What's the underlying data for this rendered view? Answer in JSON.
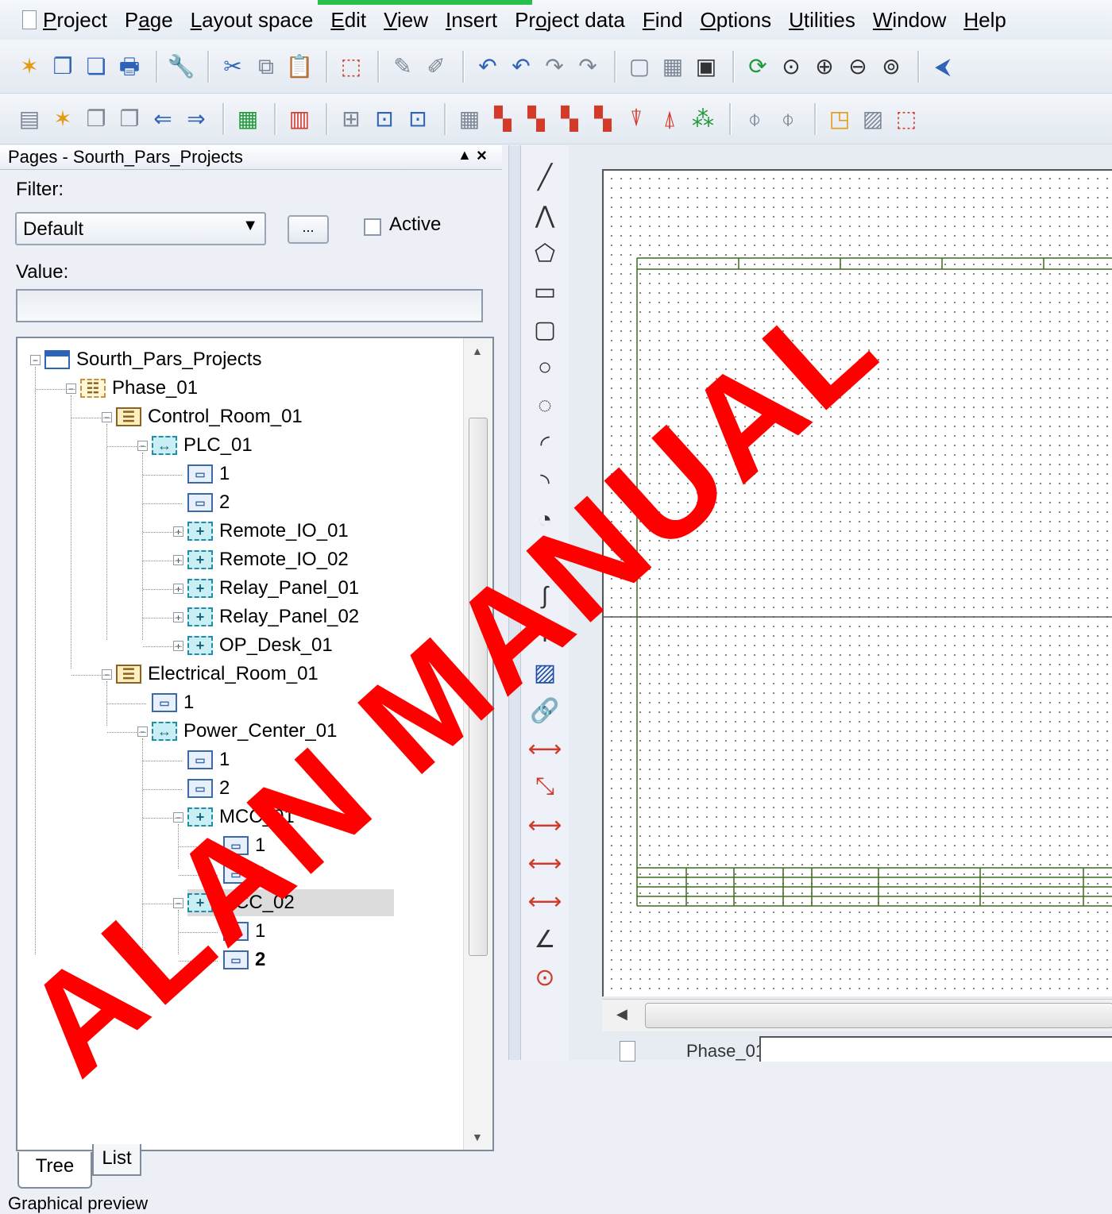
{
  "menubar": {
    "items": [
      {
        "pre": "",
        "acc": "P",
        "post": "roject"
      },
      {
        "pre": "P",
        "acc": "a",
        "post": "ge"
      },
      {
        "pre": "",
        "acc": "L",
        "post": "ayout space"
      },
      {
        "pre": "",
        "acc": "E",
        "post": "dit"
      },
      {
        "pre": "",
        "acc": "V",
        "post": "iew"
      },
      {
        "pre": "",
        "acc": "I",
        "post": "nsert"
      },
      {
        "pre": "Pr",
        "acc": "o",
        "post": "ject data"
      },
      {
        "pre": "",
        "acc": "F",
        "post": "ind"
      },
      {
        "pre": "",
        "acc": "O",
        "post": "ptions"
      },
      {
        "pre": "",
        "acc": "U",
        "post": "tilities"
      },
      {
        "pre": "",
        "acc": "W",
        "post": "indow"
      },
      {
        "pre": "",
        "acc": "H",
        "post": "elp"
      }
    ]
  },
  "toolbar1": [
    {
      "name": "new-project-icon",
      "glyph": "✶",
      "color": "c-orange"
    },
    {
      "name": "open-project-icon",
      "glyph": "❐",
      "color": "c-blue"
    },
    {
      "name": "close-project-icon",
      "glyph": "❏",
      "color": "c-blue"
    },
    {
      "name": "print-icon",
      "glyph": "🖶",
      "color": "c-blue"
    },
    {
      "sep": true
    },
    {
      "name": "settings-wrench-icon",
      "glyph": "🔧",
      "color": "c-orange"
    },
    {
      "sep": true
    },
    {
      "name": "cut-icon",
      "glyph": "✂",
      "color": "c-blue"
    },
    {
      "name": "copy-icon",
      "glyph": "⧉",
      "color": "c-gray"
    },
    {
      "name": "paste-icon",
      "glyph": "📋",
      "color": "c-orange"
    },
    {
      "sep": true
    },
    {
      "name": "delete-selection-icon",
      "glyph": "⬚",
      "color": "c-red"
    },
    {
      "sep": true
    },
    {
      "name": "format-brush-icon",
      "glyph": "✎",
      "color": "c-gray"
    },
    {
      "name": "format-apply-icon",
      "glyph": "✐",
      "color": "c-gray"
    },
    {
      "sep": true
    },
    {
      "name": "undo-icon",
      "glyph": "↶",
      "color": "c-blue"
    },
    {
      "name": "undo-list-icon",
      "glyph": "↶",
      "color": "c-blue"
    },
    {
      "name": "redo-icon",
      "glyph": "↷",
      "color": "c-gray"
    },
    {
      "name": "redo-list-icon",
      "glyph": "↷",
      "color": "c-gray"
    },
    {
      "sep": true
    },
    {
      "name": "page-icon",
      "glyph": "▢",
      "color": "c-gray"
    },
    {
      "name": "grid-icon",
      "glyph": "▦",
      "color": "c-gray"
    },
    {
      "name": "graphic-view-icon",
      "glyph": "▣",
      "color": "c-black"
    },
    {
      "sep": true
    },
    {
      "name": "refresh-icon",
      "glyph": "⟳",
      "color": "c-green"
    },
    {
      "name": "zoom-window-icon",
      "glyph": "⊙",
      "color": "c-black"
    },
    {
      "name": "zoom-in-icon",
      "glyph": "⊕",
      "color": "c-black"
    },
    {
      "name": "zoom-out-icon",
      "glyph": "⊖",
      "color": "c-black"
    },
    {
      "name": "zoom-100-icon",
      "glyph": "⊚",
      "color": "c-black"
    },
    {
      "sep": true
    },
    {
      "name": "back-arrow-icon",
      "glyph": "⮜",
      "color": "c-blue"
    }
  ],
  "toolbar2": [
    {
      "name": "page-properties-icon",
      "glyph": "▤",
      "color": "c-gray"
    },
    {
      "name": "new-page-icon",
      "glyph": "✶",
      "color": "c-orange"
    },
    {
      "name": "open-page-icon",
      "glyph": "❐",
      "color": "c-gray"
    },
    {
      "name": "page-copy-icon",
      "glyph": "❐",
      "color": "c-gray"
    },
    {
      "name": "previous-page-icon",
      "glyph": "⇐",
      "color": "c-blue"
    },
    {
      "name": "next-page-icon",
      "glyph": "⇒",
      "color": "c-blue"
    },
    {
      "sep": true
    },
    {
      "name": "insert-symbol-icon",
      "glyph": "▦",
      "color": "c-green"
    },
    {
      "sep": true
    },
    {
      "name": "plc-box-icon",
      "glyph": "▥",
      "color": "c-red"
    },
    {
      "sep": true
    },
    {
      "name": "device-icon",
      "glyph": "⊞",
      "color": "c-gray"
    },
    {
      "name": "terminal-icon",
      "glyph": "⊡",
      "color": "c-blue"
    },
    {
      "name": "terminal-strip-icon",
      "glyph": "⊡",
      "color": "c-blue"
    },
    {
      "sep": true
    },
    {
      "name": "connector-icon",
      "glyph": "▦",
      "color": "c-gray"
    },
    {
      "name": "cable-icon",
      "glyph": "▚",
      "color": "c-red"
    },
    {
      "name": "cable-definition-icon",
      "glyph": "▚",
      "color": "c-red"
    },
    {
      "name": "shield-icon",
      "glyph": "▚",
      "color": "c-red"
    },
    {
      "name": "potential-icon",
      "glyph": "▚",
      "color": "c-red"
    },
    {
      "name": "interruption-point-icon",
      "glyph": "⍒",
      "color": "c-red"
    },
    {
      "name": "interruption-point-up-icon",
      "glyph": "⍋",
      "color": "c-red"
    },
    {
      "name": "network-definition-icon",
      "glyph": "⁂",
      "color": "c-green"
    },
    {
      "sep": true
    },
    {
      "name": "plug-icon",
      "glyph": "⌽",
      "color": "c-gray"
    },
    {
      "name": "plug-pin-icon",
      "glyph": "⌽",
      "color": "c-gray"
    },
    {
      "sep": true
    },
    {
      "name": "structure-box-icon",
      "glyph": "◳",
      "color": "c-orange"
    },
    {
      "name": "hatch-icon",
      "glyph": "▨",
      "color": "c-gray"
    },
    {
      "name": "black-box-icon",
      "glyph": "⬚",
      "color": "c-red"
    }
  ],
  "panel": {
    "title": "Pages - Sourth_Pars_Projects",
    "pin": "▲",
    "close": "×",
    "filter_label": "Filter:",
    "filter_value": "Default",
    "filter_arrow": "▼",
    "more_button": "...",
    "active_label": "Active",
    "value_label": "Value:",
    "value_input": ""
  },
  "tree": [
    {
      "label": "Sourth_Pars_Projects",
      "icon": "ic-project",
      "glyph": "",
      "level": 0,
      "exp": "−"
    },
    {
      "label": "Phase_01",
      "icon": "ic-phase",
      "glyph": "☷",
      "level": 1,
      "exp": "−"
    },
    {
      "label": "Control_Room_01",
      "icon": "ic-room",
      "glyph": "☰",
      "level": 2,
      "exp": "−"
    },
    {
      "label": "PLC_01",
      "icon": "ic-plc",
      "glyph": "↔",
      "level": 3,
      "exp": "−"
    },
    {
      "label": "1",
      "icon": "ic-page",
      "glyph": "▭",
      "level": 4,
      "exp": ""
    },
    {
      "label": "2",
      "icon": "ic-page",
      "glyph": "▭",
      "level": 4,
      "exp": ""
    },
    {
      "label": "Remote_IO_01",
      "icon": "ic-loc",
      "glyph": "+",
      "level": 4,
      "exp": "+"
    },
    {
      "label": "Remote_IO_02",
      "icon": "ic-loc",
      "glyph": "+",
      "level": 4,
      "exp": "+"
    },
    {
      "label": "Relay_Panel_01",
      "icon": "ic-loc",
      "glyph": "+",
      "level": 4,
      "exp": "+"
    },
    {
      "label": "Relay_Panel_02",
      "icon": "ic-loc",
      "glyph": "+",
      "level": 4,
      "exp": "+"
    },
    {
      "label": "OP_Desk_01",
      "icon": "ic-loc",
      "glyph": "+",
      "level": 4,
      "exp": "+"
    },
    {
      "label": "Electrical_Room_01",
      "icon": "ic-room",
      "glyph": "☰",
      "level": 2,
      "exp": "−"
    },
    {
      "label": "1",
      "icon": "ic-page",
      "glyph": "▭",
      "level": 3,
      "exp": ""
    },
    {
      "label": "Power_Center_01",
      "icon": "ic-plc",
      "glyph": "↔",
      "level": 3,
      "exp": "−"
    },
    {
      "label": "1",
      "icon": "ic-page",
      "glyph": "▭",
      "level": 4,
      "exp": ""
    },
    {
      "label": "2",
      "icon": "ic-page",
      "glyph": "▭",
      "level": 4,
      "exp": ""
    },
    {
      "label": "MCC_01",
      "icon": "ic-loc",
      "glyph": "+",
      "level": 4,
      "exp": "−"
    },
    {
      "label": "1",
      "icon": "ic-page",
      "glyph": "▭",
      "level": 5,
      "exp": ""
    },
    {
      "label": "2",
      "icon": "ic-page",
      "glyph": "▭",
      "level": 5,
      "exp": ""
    },
    {
      "label": "MCC_02",
      "icon": "ic-loc",
      "glyph": "+",
      "level": 4,
      "exp": "−",
      "selected": true
    },
    {
      "label": "1",
      "icon": "ic-page",
      "glyph": "▭",
      "level": 5,
      "exp": ""
    },
    {
      "label": "2",
      "icon": "ic-page",
      "glyph": "▭",
      "level": 5,
      "exp": "",
      "bold": true
    }
  ],
  "tabs": {
    "tree": "Tree",
    "list": "List"
  },
  "graphical_preview": "Graphical preview",
  "draw_tools": [
    {
      "name": "line-tool-icon",
      "glyph": "╱",
      "cls": ""
    },
    {
      "name": "polyline-tool-icon",
      "glyph": "⋀",
      "cls": ""
    },
    {
      "name": "polygon-tool-icon",
      "glyph": "⬠",
      "cls": ""
    },
    {
      "name": "rectangle-tool-icon",
      "glyph": "▭",
      "cls": ""
    },
    {
      "name": "rounded-rectangle-tool-icon",
      "glyph": "▢",
      "cls": ""
    },
    {
      "name": "circle-tool-icon",
      "glyph": "○",
      "cls": ""
    },
    {
      "name": "circle-three-points-tool-icon",
      "glyph": "◌",
      "cls": ""
    },
    {
      "name": "arc-tool-icon",
      "glyph": "◜",
      "cls": ""
    },
    {
      "name": "arc-three-points-tool-icon",
      "glyph": "◝",
      "cls": ""
    },
    {
      "name": "sector-tool-icon",
      "glyph": "◔",
      "cls": ""
    },
    {
      "name": "ellipse-tool-icon",
      "glyph": "⬭",
      "cls": ""
    },
    {
      "name": "spline-tool-icon",
      "glyph": "∫",
      "cls": ""
    },
    {
      "name": "text-tool-icon",
      "glyph": "T",
      "cls": ""
    },
    {
      "name": "image-tool-icon",
      "glyph": "▨",
      "cls": "blue"
    },
    {
      "name": "hyperlink-tool-icon",
      "glyph": "🔗",
      "cls": "blue"
    },
    {
      "name": "dimension-linear-tool-icon",
      "glyph": "⟷",
      "cls": "red"
    },
    {
      "name": "dimension-aligned-tool-icon",
      "glyph": "⤡",
      "cls": "red"
    },
    {
      "name": "dimension-chain-tool-icon",
      "glyph": "⟷",
      "cls": "red"
    },
    {
      "name": "dimension-incremental-tool-icon",
      "glyph": "⟷",
      "cls": "red"
    },
    {
      "name": "dimension-baseline-tool-icon",
      "glyph": "⟷",
      "cls": "red"
    },
    {
      "name": "dimension-angle-tool-icon",
      "glyph": "∠",
      "cls": ""
    },
    {
      "name": "dimension-radius-tool-icon",
      "glyph": "⊙",
      "cls": "red"
    }
  ],
  "canvas": {
    "page_tab_label": "Phase_01",
    "scroll_left": "◀"
  },
  "watermark": "ALAN MANUAL"
}
